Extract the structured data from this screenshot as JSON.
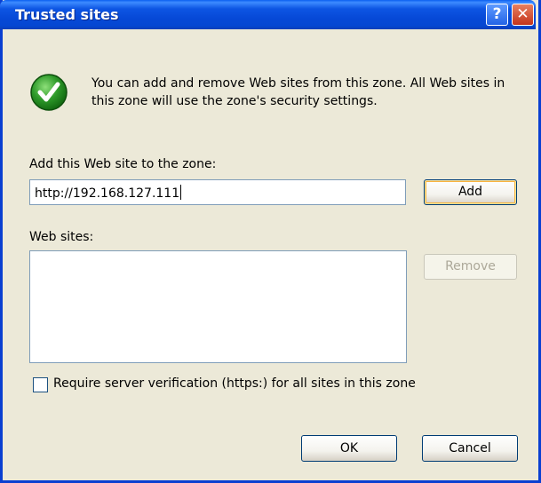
{
  "window": {
    "title": "Trusted sites",
    "help_glyph": "?",
    "close_glyph": "✕"
  },
  "info": {
    "icon": "green-checkmark-icon",
    "description": "You can add and remove Web sites from this zone. All Web sites in this zone will use the zone's security settings."
  },
  "add_site": {
    "label": "Add this Web site to the zone:",
    "value": "http://192.168.127.111",
    "button_label": "Add"
  },
  "web_sites": {
    "label": "Web sites:",
    "items": [],
    "remove_label": "Remove"
  },
  "https_option": {
    "label": "Require server verification (https:) for all sites in this zone",
    "checked": false
  },
  "footer": {
    "ok_label": "OK",
    "cancel_label": "Cancel"
  }
}
